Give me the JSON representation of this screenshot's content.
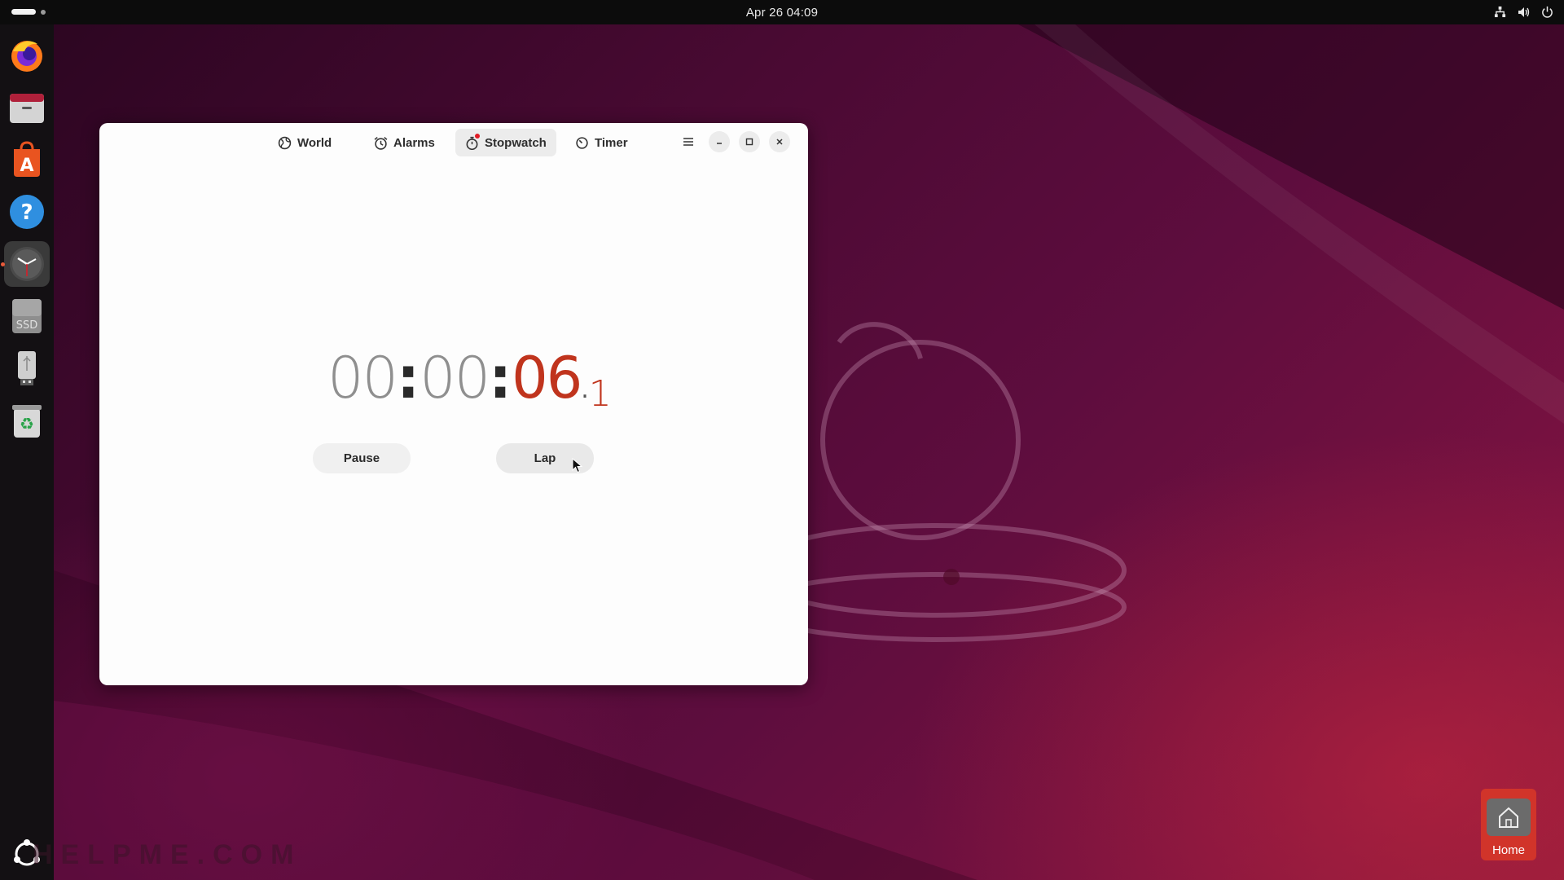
{
  "topbar": {
    "datetime": "Apr 26  04:09",
    "tray_icons": [
      "network-icon",
      "volume-icon",
      "power-icon"
    ]
  },
  "dock": {
    "items": [
      {
        "name": "firefox-icon"
      },
      {
        "name": "files-icon"
      },
      {
        "name": "app-center-icon"
      },
      {
        "name": "help-icon"
      },
      {
        "name": "clocks-icon",
        "active": true
      },
      {
        "name": "ssd-drive-icon",
        "label": "SSD"
      },
      {
        "name": "usb-drive-icon"
      },
      {
        "name": "trash-icon"
      },
      {
        "name": "show-apps-icon"
      }
    ]
  },
  "window": {
    "tabs": [
      {
        "label": "World",
        "icon": "globe-icon"
      },
      {
        "label": "Alarms",
        "icon": "alarm-icon"
      },
      {
        "label": "Stopwatch",
        "icon": "stopwatch-icon",
        "selected": true,
        "badge": true
      },
      {
        "label": "Timer",
        "icon": "timer-icon"
      }
    ],
    "controls": [
      "menu-icon",
      "minimize-icon",
      "maximize-icon",
      "close-icon"
    ],
    "stopwatch": {
      "hours": "00",
      "minutes": "00",
      "seconds": "06",
      "tenths": "1"
    },
    "buttons": {
      "pause": "Pause",
      "lap": "Lap"
    }
  },
  "desktop": {
    "home_label": "Home",
    "watermark": "HELPME.COM"
  },
  "colors": {
    "accent": "#c0341d",
    "topbar": "#0c0c0c",
    "dock": "#131013"
  }
}
